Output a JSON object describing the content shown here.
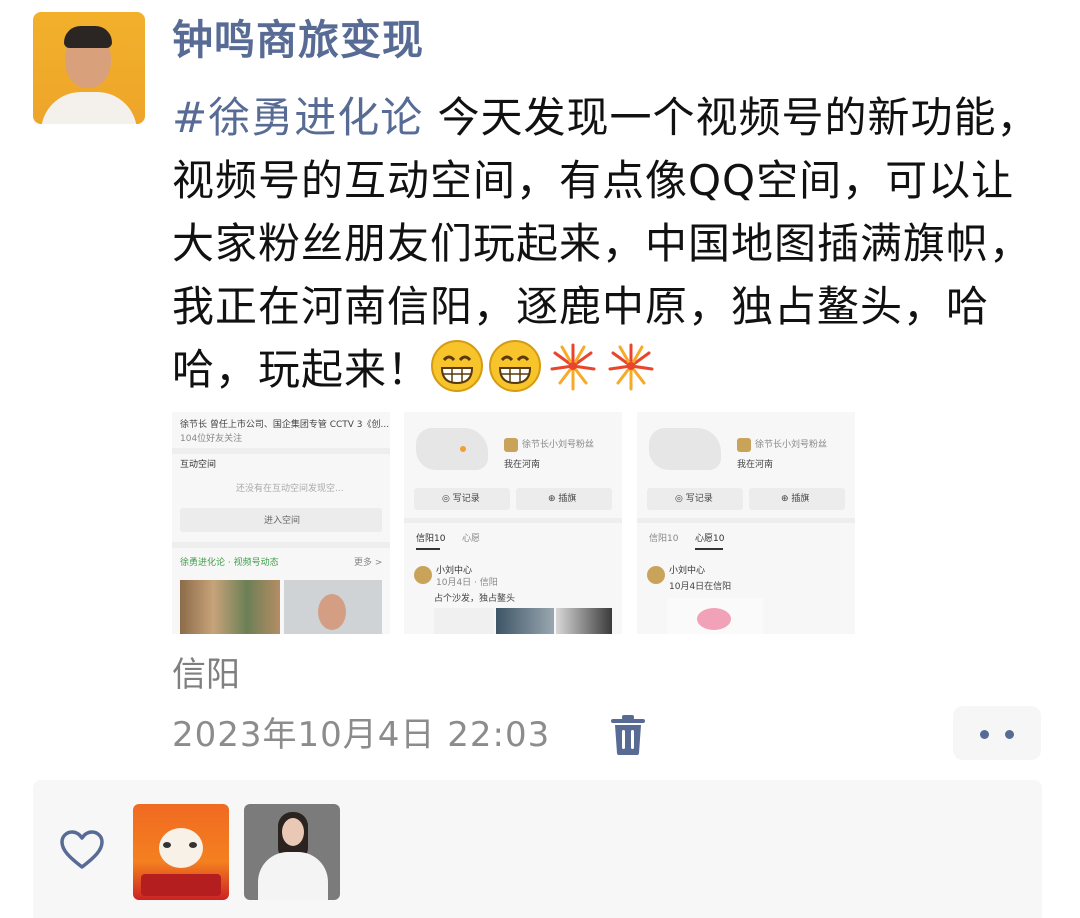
{
  "author": {
    "name": "钟鸣商旅变现"
  },
  "post": {
    "hashtag": "#徐勇进化论",
    "text": " 今天发现一个视频号的新功能，视频号的互动空间，有点像QQ空间，可以让大家粉丝朋友们玩起来，中国地图插满旗帜，我正在河南信阳，逐鹿中原，独占鳌头，哈哈，玩起来！",
    "emojis": [
      "grin-emoji",
      "grin-emoji",
      "fireworks-emoji",
      "fireworks-emoji"
    ]
  },
  "images": [
    {
      "line1": "徐节长 曾任上市公司、国企集团专管 CCTV 3《创...",
      "line2": "104位好友关注",
      "section": "互动空间",
      "hint": "还没有在互动空间发现空...",
      "button": "进入空间",
      "feed_title": "徐勇进化论 · 视频号动态",
      "feed_more": "更多 >"
    },
    {
      "user_line": "徐节长小刘号粉丝",
      "sub_line": "我在河南",
      "btn1": "◎ 写记录",
      "btn2": "⊕ 插旗",
      "tab1": "信阳10",
      "tab2": "心愿",
      "poster": "小刘中心",
      "poster_meta": "10月4日 · 信阳",
      "post_text": "占个沙发，独占鳌头"
    },
    {
      "user_line": "徐节长小刘号粉丝",
      "sub_line": "我在河南",
      "btn1": "◎ 写记录",
      "btn2": "⊕ 插旗",
      "tab1": "信阳10",
      "tab2": "心愿10",
      "poster": "小刘中心",
      "post_text": "10月4日在信阳"
    }
  ],
  "meta": {
    "location": "信阳",
    "timestamp": "2023年10月4日 22:03"
  },
  "actions": {
    "delete_icon": "trash-icon",
    "more_icon": "more-dots-icon"
  },
  "likes": {
    "icon": "heart-outline-icon",
    "users": [
      "liker-avatar-lucky-cat",
      "liker-avatar-woman-white-coat"
    ]
  },
  "colors": {
    "link_blue": "#576b95",
    "text": "#111111",
    "muted": "#8c8c8c",
    "panel": "#f7f7f7"
  }
}
